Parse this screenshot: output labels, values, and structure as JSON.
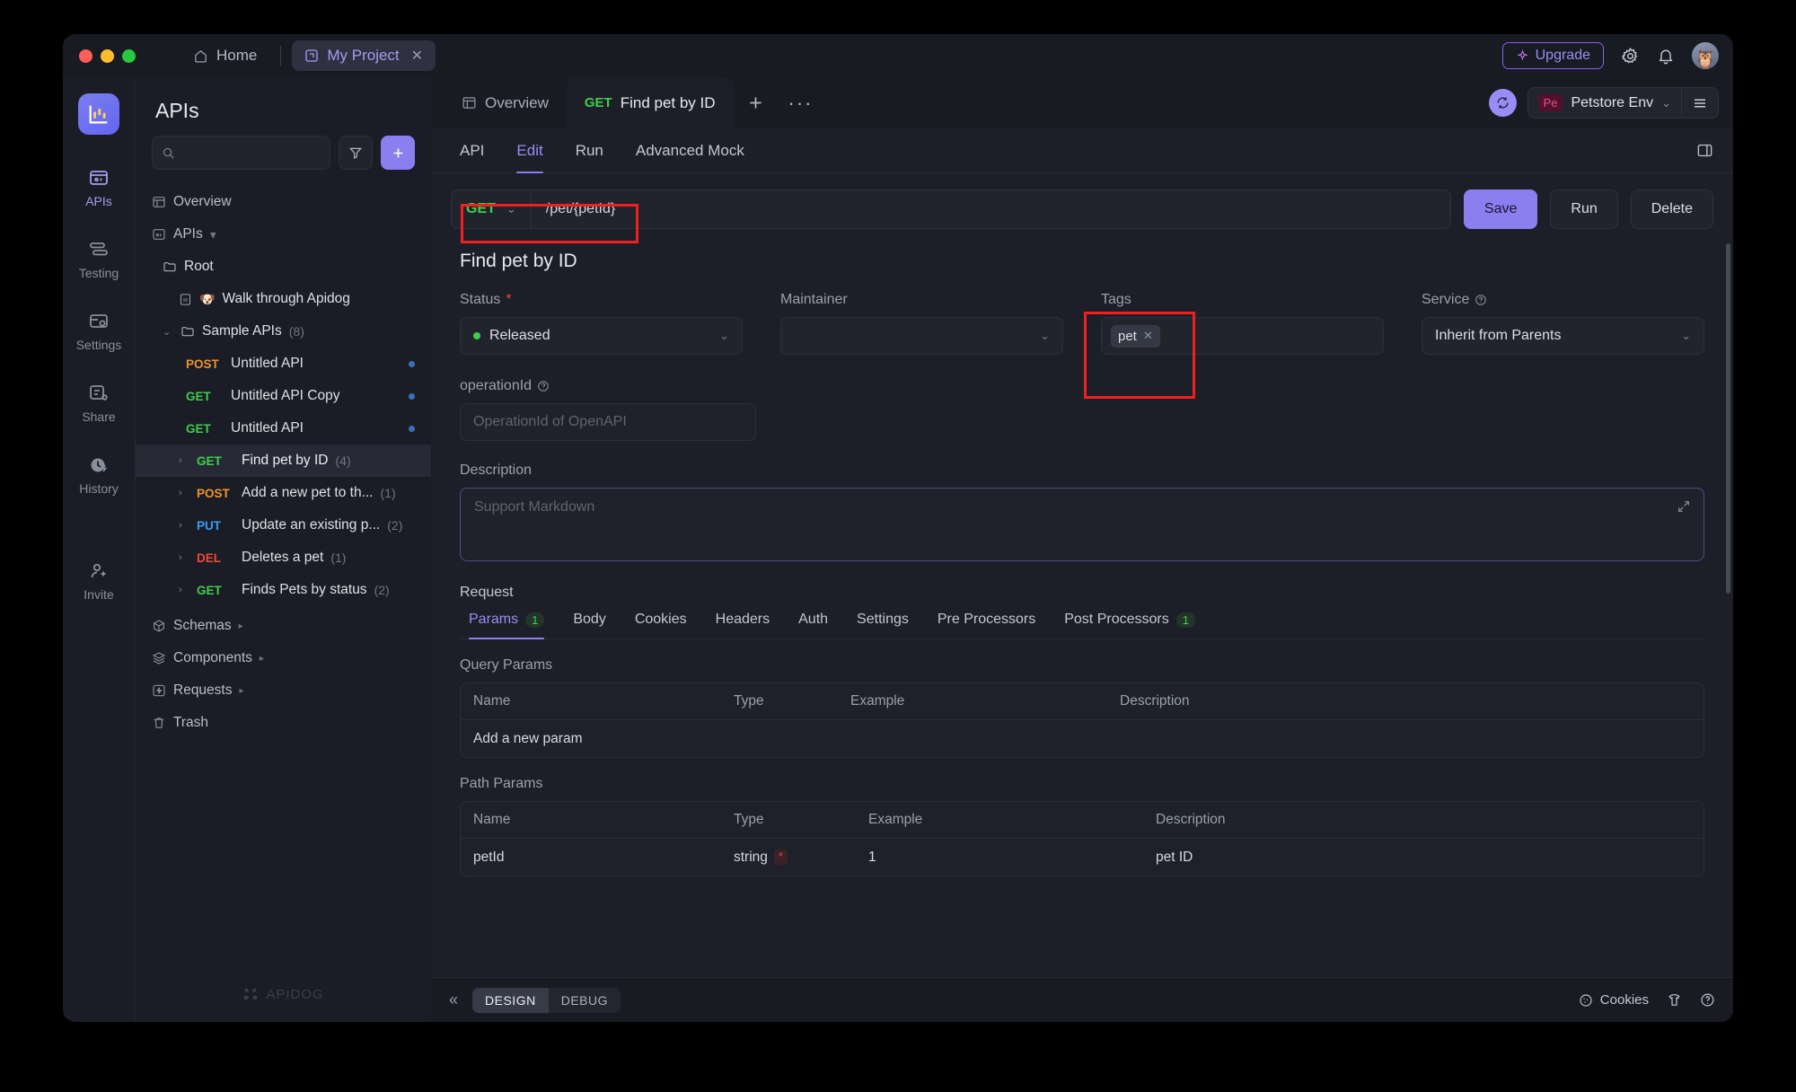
{
  "titlebar": {
    "home_label": "Home",
    "project_tab": "My Project",
    "upgrade_label": "Upgrade",
    "icons": [
      "gear-icon",
      "bell-icon",
      "avatar"
    ]
  },
  "rail": {
    "items": [
      {
        "label": "APIs",
        "icon": "apis-icon",
        "active": true
      },
      {
        "label": "Testing",
        "icon": "testing-icon",
        "active": false
      },
      {
        "label": "Settings",
        "icon": "settings-icon",
        "active": false
      },
      {
        "label": "Share",
        "icon": "share-icon",
        "active": false
      },
      {
        "label": "History",
        "icon": "history-icon",
        "active": false
      },
      {
        "label": "Invite",
        "icon": "invite-icon",
        "active": false
      }
    ]
  },
  "tree": {
    "title": "APIs",
    "search_placeholder": "",
    "search_value": "",
    "filter_icon": "filter-icon",
    "add_icon": "plus-icon",
    "watermark": "APIDOG",
    "items": [
      {
        "label": "Overview",
        "icon": "overview-icon",
        "indent": 0
      },
      {
        "label": "APIs",
        "icon": "apis-small-icon",
        "indent": 0,
        "caret": "▾"
      },
      {
        "label": "Root",
        "icon": "folder-icon",
        "indent": 1
      },
      {
        "label": "Walk through Apidog",
        "icon": "markdown-icon",
        "emoji": "🐶",
        "indent": 2
      },
      {
        "label": "Sample APIs",
        "icon": "folder-icon",
        "indent": 1,
        "count": "(8)",
        "caret": "⌄"
      },
      {
        "method": "POST",
        "label": "Untitled API",
        "indent": 2,
        "dot": true
      },
      {
        "method": "GET",
        "label": "Untitled API Copy",
        "indent": 2,
        "dot": true
      },
      {
        "method": "GET",
        "label": "Untitled API",
        "indent": 2,
        "dot": true
      },
      {
        "method": "GET",
        "label": "Find pet by ID",
        "count": "(4)",
        "indent": 2,
        "caret": "›",
        "selected": true
      },
      {
        "method": "POST",
        "label": "Add a new pet to th...",
        "count": "(1)",
        "indent": 2,
        "caret": "›"
      },
      {
        "method": "PUT",
        "label": "Update an existing p...",
        "count": "(2)",
        "indent": 2,
        "caret": "›"
      },
      {
        "method": "DEL",
        "label": "Deletes a pet",
        "count": "(1)",
        "indent": 2,
        "caret": "›"
      },
      {
        "method": "GET",
        "label": "Finds Pets by status",
        "count": "(2)",
        "indent": 2,
        "caret": "›"
      },
      {
        "label": "Schemas",
        "icon": "schemas-icon",
        "indent": 0,
        "caret": "▸"
      },
      {
        "label": "Components",
        "icon": "components-icon",
        "indent": 0,
        "caret": "▸"
      },
      {
        "label": "Requests",
        "icon": "requests-icon",
        "indent": 0,
        "caret": "▸"
      },
      {
        "label": "Trash",
        "icon": "trash-icon",
        "indent": 0
      }
    ]
  },
  "main": {
    "tabs": [
      {
        "label": "Overview",
        "icon": "overview-icon",
        "active": false
      },
      {
        "method": "GET",
        "label": "Find pet by ID",
        "active": true
      }
    ],
    "add_tab_icon": "plus-icon",
    "more_tabs_icon": "ellipsis-icon",
    "sync_icon": "sync-icon",
    "env": {
      "badge": "Pe",
      "name": "Petstore Env",
      "chevron": "⌄"
    },
    "burger_icon": "menu-icon",
    "sub_tabs": [
      {
        "label": "API",
        "active": false
      },
      {
        "label": "Edit",
        "active": true
      },
      {
        "label": "Run",
        "active": false
      },
      {
        "label": "Advanced Mock",
        "active": false
      }
    ],
    "panel_toggle_icon": "right-panel-icon"
  },
  "urlbar": {
    "method": "GET",
    "method_chevron": "⌄",
    "path": "/pet/{petId}",
    "save_label": "Save",
    "run_label": "Run",
    "delete_label": "Delete"
  },
  "doc": {
    "title": "Find pet by ID",
    "fields": {
      "status": {
        "label": "Status",
        "required": "*",
        "value": "Released",
        "chevron": "⌄"
      },
      "maintainer": {
        "label": "Maintainer",
        "value": "",
        "chevron": "⌄"
      },
      "tags": {
        "label": "Tags",
        "chips": [
          "pet"
        ],
        "chip_close": "✕"
      },
      "service": {
        "label": "Service",
        "help_icon": "help-icon",
        "value": "Inherit from Parents",
        "chevron": "⌄"
      }
    },
    "operation_id": {
      "label": "operationId",
      "help_icon": "help-icon",
      "placeholder": "OperationId of OpenAPI",
      "value": ""
    },
    "description": {
      "label": "Description",
      "placeholder": "Support Markdown",
      "value": "",
      "expand_icon": "expand-icon"
    },
    "request": {
      "section_label": "Request",
      "tabs": [
        {
          "label": "Params",
          "badge": "1",
          "active": true
        },
        {
          "label": "Body",
          "active": false
        },
        {
          "label": "Cookies",
          "active": false
        },
        {
          "label": "Headers",
          "active": false
        },
        {
          "label": "Auth",
          "active": false
        },
        {
          "label": "Settings",
          "active": false
        },
        {
          "label": "Pre Processors",
          "active": false
        },
        {
          "label": "Post Processors",
          "badge": "1",
          "active": false
        }
      ],
      "query_params": {
        "label": "Query Params",
        "columns": [
          "Name",
          "Type",
          "Example",
          "Description"
        ],
        "rows": [],
        "add_placeholder": "Add a new param"
      },
      "path_params": {
        "label": "Path Params",
        "columns": [
          "Name",
          "Type",
          "Example",
          "Description"
        ],
        "rows": [
          {
            "name": "petId",
            "type": "string",
            "required": "*",
            "example": "1",
            "description": "pet ID"
          }
        ]
      }
    }
  },
  "bottombar": {
    "collapse_icon": "collapse-left-icon",
    "modes": [
      {
        "label": "DESIGN",
        "active": true
      },
      {
        "label": "DEBUG",
        "active": false
      }
    ],
    "cookies_label": "Cookies",
    "cookies_icon": "cookie-icon",
    "shirt_icon": "theme-icon",
    "help_icon": "help-circle-icon"
  },
  "annotations": {
    "accent": "#f02020",
    "boxes": [
      "method-url-highlight",
      "tags-highlight"
    ]
  }
}
